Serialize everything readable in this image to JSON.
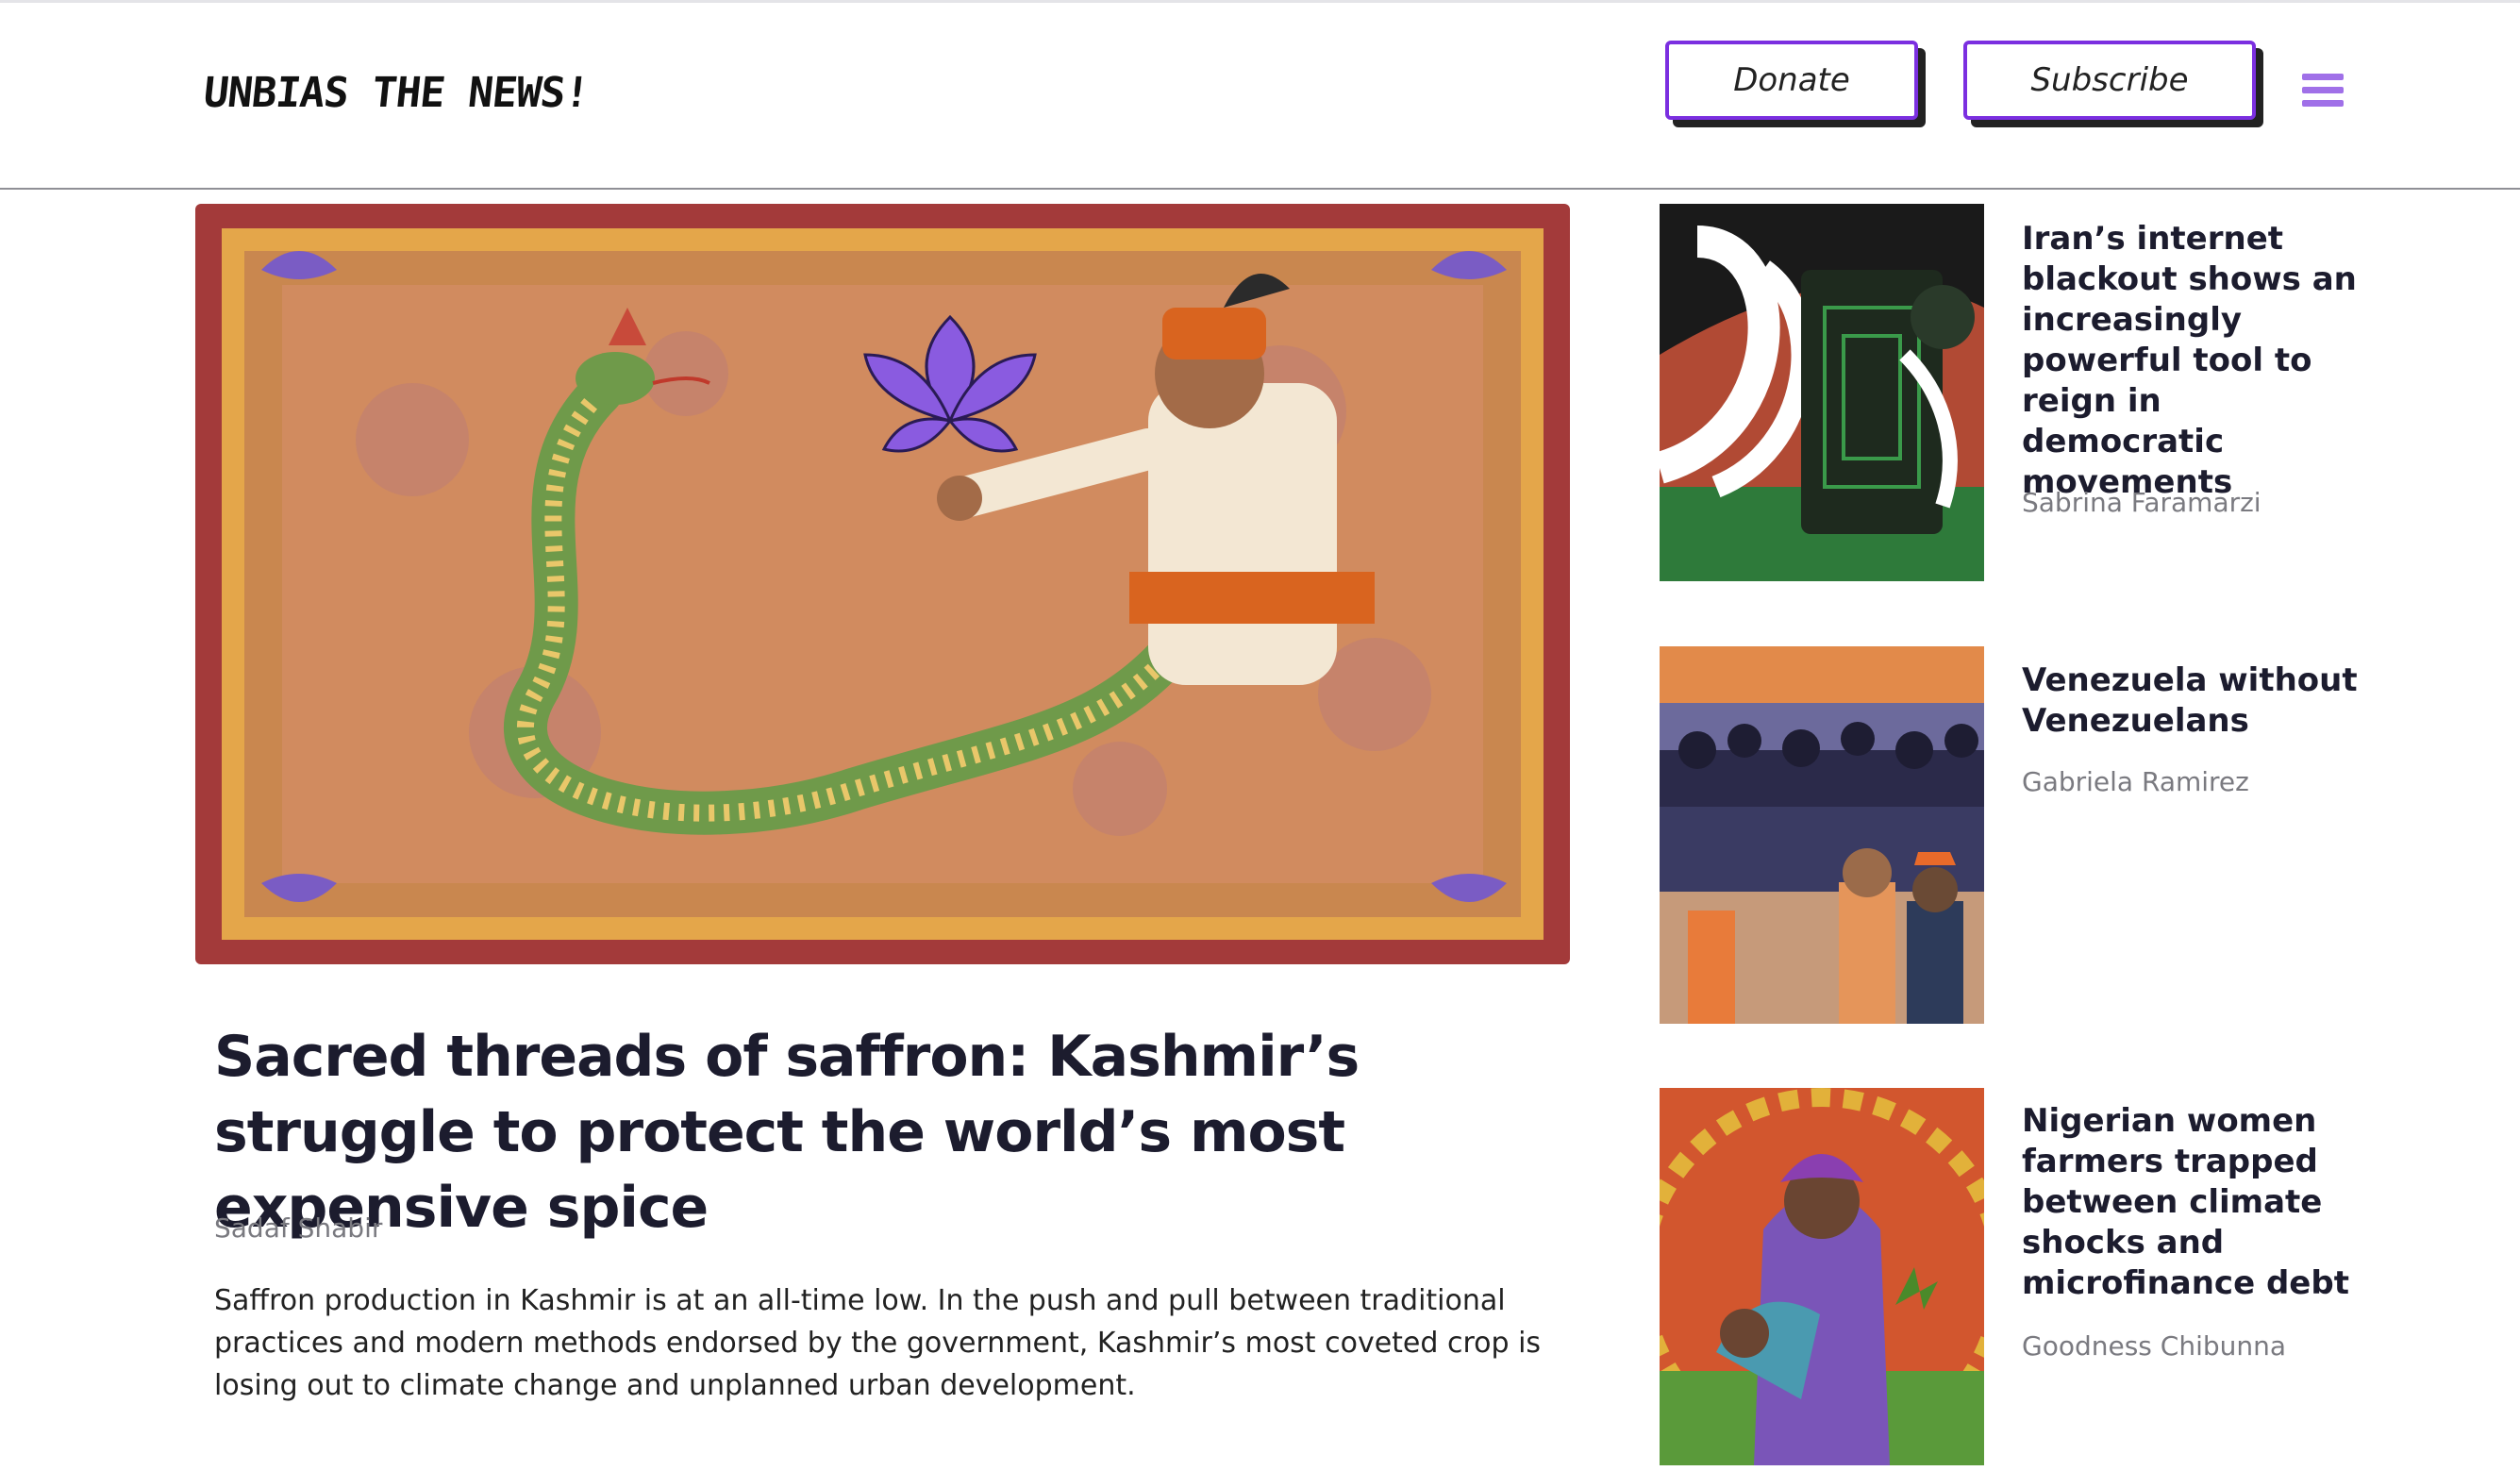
{
  "header": {
    "logo_text": "UNBIAS THE NEWS!",
    "donate_label": "Donate",
    "subscribe_label": "Subscribe",
    "menu_icon": "hamburger-menu-icon"
  },
  "featured": {
    "title": "Sacred threads of saffron: Kashmir’s struggle to protect the world’s most expensive spice",
    "author": "Sadaf Shabir",
    "summary": "Saffron production in Kashmir is at an all-time low. In the push and pull between traditional practices and modern methods endorsed by the government, Kashmir’s most coveted crop is losing out to climate change and unplanned urban development."
  },
  "stories": [
    {
      "title": "Iran’s internet blackout shows an increasingly powerful tool to reign in democratic movements",
      "author": "Sabrina Faramarzi"
    },
    {
      "title": "Venezuela without Venezuelans",
      "author": "Gabriela Ramirez"
    },
    {
      "title": "Nigerian women farmers trapped between climate shocks and microfinance debt",
      "author": "Goodness Chibunna"
    }
  ],
  "colors": {
    "accent": "#7b2fe0",
    "menu": "#a070e8",
    "title": "#1c1c2e",
    "byline": "#7a7a80"
  }
}
